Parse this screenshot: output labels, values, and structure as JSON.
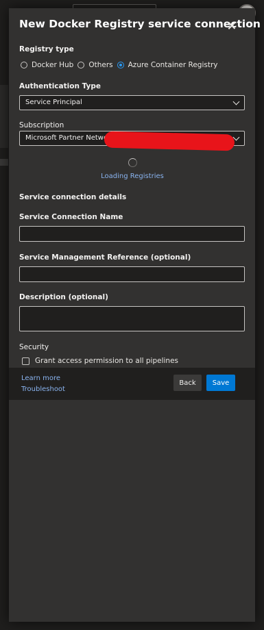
{
  "dialog": {
    "title": "New Docker Registry service connection",
    "registry_type_label": "Registry type",
    "registry_options": [
      "Docker Hub",
      "Others",
      "Azure Container Registry"
    ],
    "selected_registry": "Azure Container Registry",
    "auth_type_label": "Authentication Type",
    "auth_type_value": "Service Principal",
    "subscription_label": "Subscription",
    "subscription_value": "Microsoft Partner Networ",
    "loading_text": "Loading Registries",
    "details_heading": "Service connection details",
    "connection_name_label": "Service Connection Name",
    "connection_name_value": "",
    "mgmt_ref_label": "Service Management Reference (optional)",
    "mgmt_ref_value": "",
    "description_label": "Description (optional)",
    "description_value": "",
    "security_label": "Security",
    "grant_access_label": "Grant access permission to all pipelines",
    "grant_access_checked": false
  },
  "footer": {
    "learn_more": "Learn more",
    "troubleshoot": "Troubleshoot",
    "back_label": "Back",
    "save_label": "Save"
  },
  "colors": {
    "panel_bg": "#323130",
    "accent": "#0078d4",
    "link": "#8ab4f0",
    "redaction": "#e8141a"
  }
}
